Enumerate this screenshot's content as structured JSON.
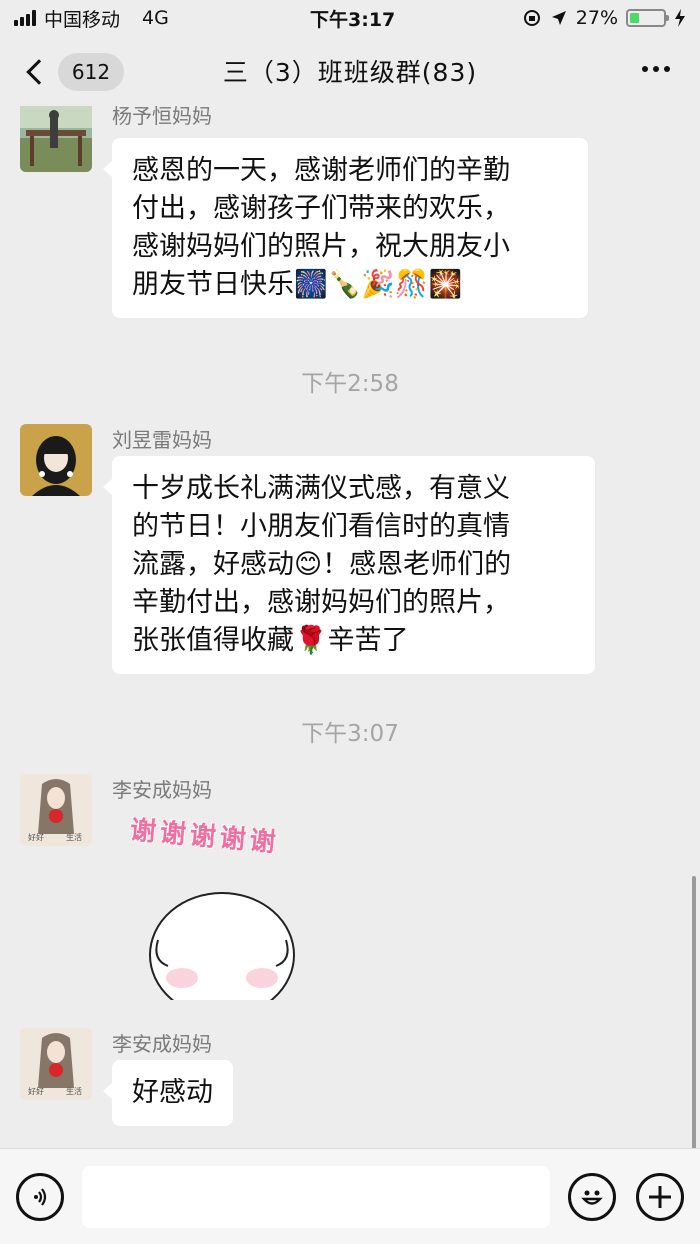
{
  "status_bar": {
    "carrier": "中国移动",
    "network": "4G",
    "time": "下午3:17",
    "battery_percent_text": "27%",
    "battery_level": 0.27
  },
  "nav": {
    "unread_count": "612",
    "title": "三（3）班班级群(83)"
  },
  "messages": [
    {
      "sender": "杨予恒妈妈",
      "lines": [
        "感恩的一天，感谢老师们的辛勤",
        "付出，感谢孩子们带来的欢乐，",
        "感谢妈妈们的照片，祝大朋友小",
        "朋友节日快乐🎆🍾🎉🎊🎇"
      ]
    },
    {
      "time": "下午2:58"
    },
    {
      "sender": "刘昱雷妈妈",
      "lines": [
        "十岁成长礼满满仪式感，有意义",
        "的节日！小朋友们看信时的真情",
        "流露，好感动😊！感恩老师们的",
        "辛勤付出，感谢妈妈们的照片，",
        "张张值得收藏🌹辛苦了"
      ]
    },
    {
      "time": "下午3:07"
    },
    {
      "sender": "李安成妈妈",
      "sticker_text": "谢谢谢谢谢"
    },
    {
      "sender": "李安成妈妈",
      "text": "好感动"
    }
  ],
  "input_bar": {
    "placeholder": ""
  },
  "colors": {
    "background": "#ededed",
    "bubble": "#ffffff",
    "battery": "#4cd964",
    "sticker_text": "#f06ea0"
  },
  "icons": [
    "back-chevron-icon",
    "more-icon",
    "voice-icon",
    "emoji-icon",
    "plus-icon"
  ]
}
